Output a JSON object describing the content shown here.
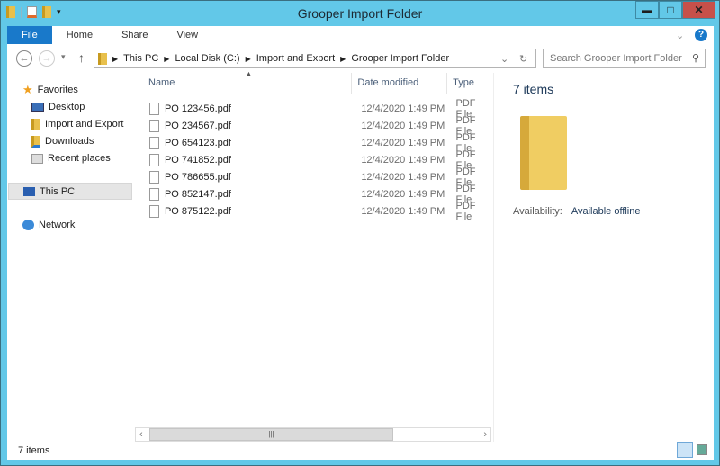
{
  "window": {
    "title": "Grooper Import Folder",
    "minimize": "▬",
    "maximize": "□",
    "close": "✕"
  },
  "ribbon": {
    "tabs": [
      "File",
      "Home",
      "Share",
      "View"
    ],
    "expand": "⌄",
    "help": "?"
  },
  "address": {
    "crumbs": [
      "This PC",
      "Local Disk (C:)",
      "Import and Export",
      "Grooper Import Folder"
    ],
    "search_placeholder": "Search Grooper Import Folder"
  },
  "nav": {
    "favorites": "Favorites",
    "items": [
      "Desktop",
      "Import and Export",
      "Downloads",
      "Recent places"
    ],
    "this_pc": "This PC",
    "network": "Network"
  },
  "list": {
    "columns": [
      "Name",
      "Date modified",
      "Type"
    ],
    "files": [
      {
        "name": "PO 123456.pdf",
        "date": "12/4/2020 1:49 PM",
        "type": "PDF File"
      },
      {
        "name": "PO 234567.pdf",
        "date": "12/4/2020 1:49 PM",
        "type": "PDF File"
      },
      {
        "name": "PO 654123.pdf",
        "date": "12/4/2020 1:49 PM",
        "type": "PDF File"
      },
      {
        "name": "PO 741852.pdf",
        "date": "12/4/2020 1:49 PM",
        "type": "PDF File"
      },
      {
        "name": "PO 786655.pdf",
        "date": "12/4/2020 1:49 PM",
        "type": "PDF File"
      },
      {
        "name": "PO 852147.pdf",
        "date": "12/4/2020 1:49 PM",
        "type": "PDF File"
      },
      {
        "name": "PO 875122.pdf",
        "date": "12/4/2020 1:49 PM",
        "type": "PDF File"
      }
    ]
  },
  "details": {
    "count": "7 items",
    "availability_label": "Availability:",
    "availability_value": "Available offline"
  },
  "status": {
    "count": "7 items"
  }
}
